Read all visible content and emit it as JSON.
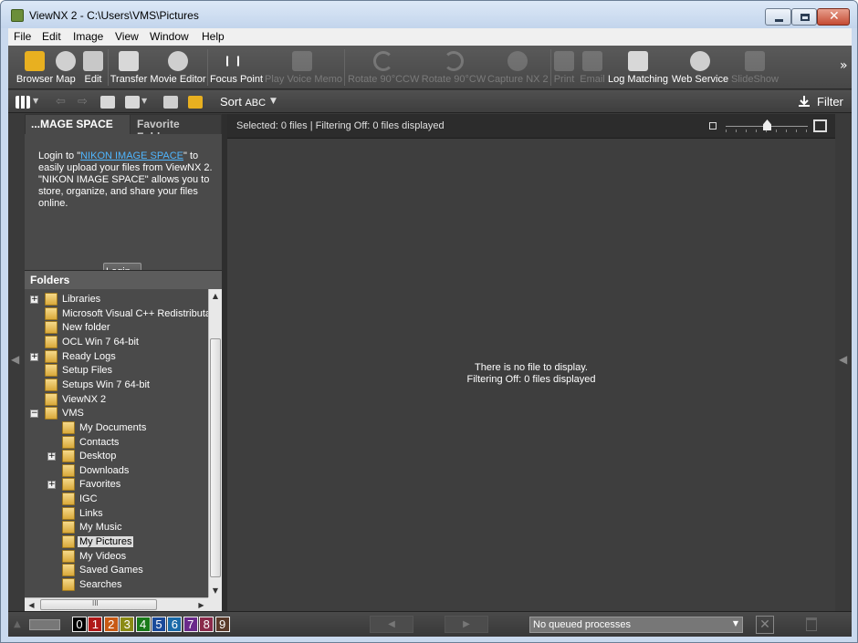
{
  "window": {
    "title": "ViewNX 2 - C:\\Users\\VMS\\Pictures"
  },
  "menu": [
    "File",
    "Edit",
    "Image",
    "View",
    "Window",
    "Help"
  ],
  "toolbar": {
    "browser": "Browser",
    "map": "Map",
    "edit": "Edit",
    "transfer": "Transfer",
    "movie_editor": "Movie Editor",
    "focus_point": "Focus Point",
    "play_voice_memo": "Play Voice Memo",
    "rotate_ccw": "Rotate 90°CCW",
    "rotate_cw": "Rotate 90°CW",
    "capture_nx2": "Capture NX 2",
    "print": "Print",
    "email": "Email",
    "log_matching": "Log Matching",
    "web_service": "Web Service",
    "slideshow": "SlideShow",
    "more": "»"
  },
  "toolbar2": {
    "sort_label": "Sort",
    "sort_value": "ABC",
    "filter": "Filter"
  },
  "left_panel": {
    "tab_active": "...MAGE SPACE",
    "tab_other": "Favorite Folders",
    "ims_text_before": "Login to \"",
    "ims_link": "NIKON IMAGE SPACE",
    "ims_text_after": "\" to easily upload your files from ViewNX 2. \"NIKON IMAGE SPACE\" allows you to store, organize, and share your files online.",
    "login_button": "Login...",
    "folders_header": "Folders",
    "tree": [
      {
        "label": "Libraries",
        "level": 0,
        "expander": "+",
        "selected": false
      },
      {
        "label": "Microsoft Visual C++ Redistributab",
        "level": 0,
        "expander": "",
        "selected": false
      },
      {
        "label": "New folder",
        "level": 0,
        "expander": "",
        "selected": false
      },
      {
        "label": "OCL Win 7 64-bit",
        "level": 0,
        "expander": "",
        "selected": false
      },
      {
        "label": "Ready Logs",
        "level": 0,
        "expander": "+",
        "selected": false
      },
      {
        "label": "Setup Files",
        "level": 0,
        "expander": "",
        "selected": false
      },
      {
        "label": "Setups Win 7 64-bit",
        "level": 0,
        "expander": "",
        "selected": false
      },
      {
        "label": "ViewNX 2",
        "level": 0,
        "expander": "",
        "selected": false
      },
      {
        "label": "VMS",
        "level": 0,
        "expander": "−",
        "selected": false
      },
      {
        "label": "My Documents",
        "level": 1,
        "expander": "",
        "selected": false
      },
      {
        "label": "Contacts",
        "level": 1,
        "expander": "",
        "selected": false
      },
      {
        "label": "Desktop",
        "level": 1,
        "expander": "+",
        "selected": false
      },
      {
        "label": "Downloads",
        "level": 1,
        "expander": "",
        "selected": false
      },
      {
        "label": "Favorites",
        "level": 1,
        "expander": "+",
        "selected": false
      },
      {
        "label": "IGC",
        "level": 1,
        "expander": "",
        "selected": false
      },
      {
        "label": "Links",
        "level": 1,
        "expander": "",
        "selected": false
      },
      {
        "label": "My Music",
        "level": 1,
        "expander": "",
        "selected": false
      },
      {
        "label": "My Pictures",
        "level": 1,
        "expander": "",
        "selected": true
      },
      {
        "label": "My Videos",
        "level": 1,
        "expander": "",
        "selected": false
      },
      {
        "label": "Saved Games",
        "level": 1,
        "expander": "",
        "selected": false
      },
      {
        "label": "Searches",
        "level": 1,
        "expander": "",
        "selected": false
      }
    ],
    "hscroll_grip": "III"
  },
  "content": {
    "status": "Selected: 0 files | Filtering Off: 0 files displayed",
    "zoom_level": 0.5,
    "empty_line1": "There is no file to display.",
    "empty_line2": "Filtering Off: 0 files displayed"
  },
  "bottom": {
    "ratings": [
      {
        "label": "0",
        "color": "#000000"
      },
      {
        "label": "1",
        "color": "#b01818"
      },
      {
        "label": "2",
        "color": "#c85a14"
      },
      {
        "label": "3",
        "color": "#8a8a14"
      },
      {
        "label": "4",
        "color": "#1a7a1a"
      },
      {
        "label": "5",
        "color": "#1a4a9a"
      },
      {
        "label": "6",
        "color": "#1a6aa8"
      },
      {
        "label": "7",
        "color": "#6a2a8a"
      },
      {
        "label": "8",
        "color": "#8a2a4a"
      },
      {
        "label": "9",
        "color": "#5a3a2a"
      }
    ],
    "queue": "No queued processes"
  }
}
